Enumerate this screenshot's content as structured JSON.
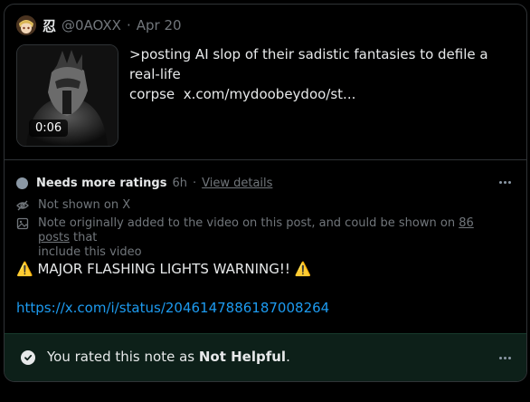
{
  "post": {
    "display_name": "忍",
    "handle": "@0AOXX",
    "separator": "·",
    "date": "Apr 20",
    "video_duration": "0:06",
    "text_line1": ">posting AI slop of their sadistic fantasies to defile a real-life",
    "text_line2_start": "corpse",
    "text_link": "x.com/mydoobeydoo/st..."
  },
  "note": {
    "status": "Needs more ratings",
    "age": "6h",
    "separator": "·",
    "details_link": "View details",
    "not_shown": "Not shown on X",
    "origin_text_start": "Note originally added to the video on this post, and could be shown on",
    "origin_count": "86 posts",
    "origin_text_mid": "that",
    "origin_text_end": "include this video",
    "warning_icon": "⚠️",
    "body": "MAJOR FLASHING LIGHTS WARNING!!",
    "url": "https://x.com/i/status/2046147886187008264"
  },
  "rating": {
    "prefix": "You rated this note as",
    "value": "Not Helpful",
    "suffix": "."
  },
  "colors": {
    "accent_link": "#1d9bf0",
    "rated_bg": "#0d2019"
  }
}
